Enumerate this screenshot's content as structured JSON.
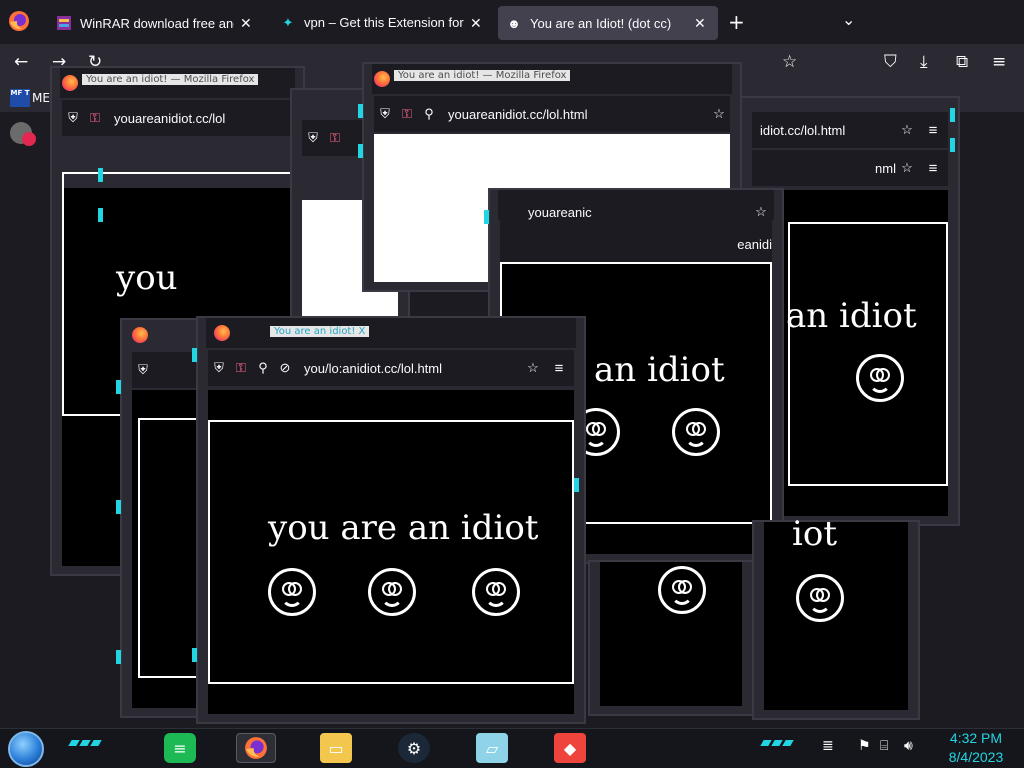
{
  "browser": {
    "tabs": [
      {
        "label": "WinRAR download free and sup",
        "icon": "winrar-icon",
        "active": false
      },
      {
        "label": "vpn – Get this Extension for 🦊 F",
        "icon": "puzzle-icon",
        "active": false
      },
      {
        "label": "You are an Idiot! (dot cc)",
        "icon": "smiley-icon",
        "active": true
      }
    ],
    "bookmark_label": "ME",
    "bookmark_icon_text": "MF T"
  },
  "popups": {
    "url": "youareanidiot.cc/lol.html",
    "url_partial_a": "youareanidiot.cc/lol",
    "url_partial_b": "youareanid",
    "url_partial_c": "you/lo:anidiot.cc/lol.html",
    "url_partial_d": "idiot.cc/lol.html",
    "url_partial_e": "/lol.html",
    "url_partial_f": "youareanic",
    "url_partial_g": "eanidi",
    "url_partial_h": "/lol",
    "url_partial_i": "nml",
    "title": "You are an idiot! — Mozilla Firefox",
    "title_short": "You are an idiot! X",
    "message_full": "you are an idiot",
    "message_mid": "an idiot",
    "message_you": "you",
    "message_iot": "iot",
    "message_y": "y"
  },
  "taskbar": {
    "time": "4:32 PM",
    "date": "8/4/2023",
    "apps": [
      "spotify-icon",
      "firefox-icon",
      "file-explorer-icon",
      "steam-icon",
      "notes-icon",
      "anydesk-icon"
    ]
  },
  "colors": {
    "accent": "#23d5e3",
    "popup_bg": "#000000",
    "chrome_bg": "#1c1b22"
  }
}
